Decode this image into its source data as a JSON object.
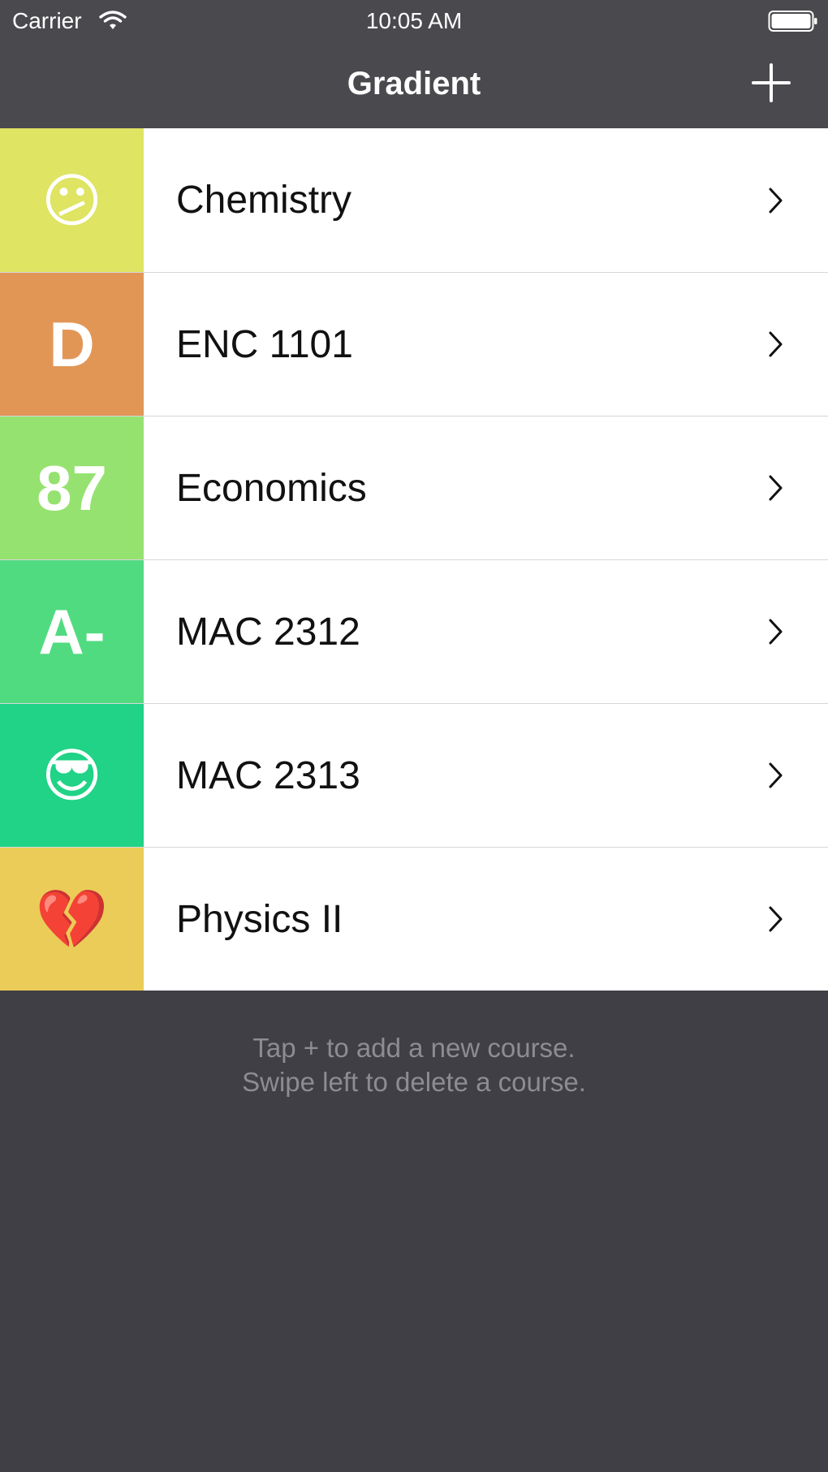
{
  "status_bar": {
    "carrier": "Carrier",
    "time": "10:05 AM",
    "wifi_icon": "wifi-icon",
    "battery_icon": "battery-icon"
  },
  "nav": {
    "title": "Gradient",
    "add_icon": "plus-icon"
  },
  "colors": {
    "nav_bar": "#4a494e",
    "background": "#403f45",
    "row_background": "#ffffff",
    "hint_text": "#8d8c92"
  },
  "courses": [
    {
      "grade": "😕",
      "grade_kind": "emoji",
      "grade_icon": "confused-face-icon",
      "name": "Chemistry",
      "color": "#dfe462"
    },
    {
      "grade": "D",
      "grade_kind": "text",
      "name": "ENC 1101",
      "color": "#e29656"
    },
    {
      "grade": "87",
      "grade_kind": "text",
      "name": "Economics",
      "color": "#95e270"
    },
    {
      "grade": "A-",
      "grade_kind": "text",
      "name": "MAC 2312",
      "color": "#51db80"
    },
    {
      "grade": "😎",
      "grade_kind": "emoji",
      "grade_icon": "sunglasses-face-icon",
      "name": "MAC 2313",
      "color": "#20d386"
    },
    {
      "grade": "💔",
      "grade_kind": "emoji",
      "grade_icon": "broken-heart-icon",
      "name": "Physics II",
      "color": "#ebcc58"
    }
  ],
  "hint": {
    "line1": "Tap + to add a new course.",
    "line2": "Swipe left to delete a course."
  }
}
